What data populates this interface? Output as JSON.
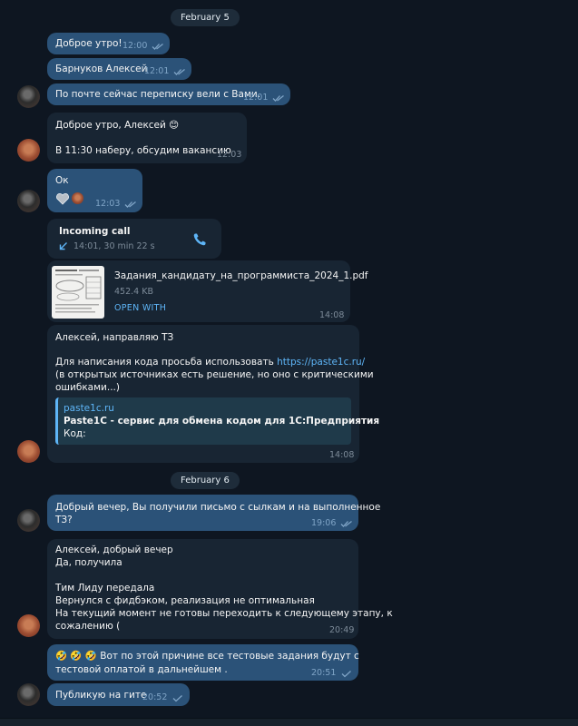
{
  "dates": {
    "d1": "February 5",
    "d2": "February 6"
  },
  "m1": {
    "text": "Доброе утро!",
    "time": "12:00"
  },
  "m2": {
    "text": "Барнуков Алексей",
    "time": "12:01"
  },
  "m3": {
    "text": "По почте сейчас переписку вели с Вами.",
    "time": "12:01"
  },
  "m4": {
    "line1": "Доброе утро, Алексей 😊",
    "line2": "В 11:30 наберу, обсудим вакансию",
    "time": "12:03"
  },
  "m5": {
    "text": "Ок",
    "time": "12:03"
  },
  "call": {
    "title": "Incoming call",
    "details": "14:01, 30 min 22 s"
  },
  "file": {
    "name": "Задания_кандидату_на_программиста_2024_1.pdf",
    "size": "452.4 KB",
    "action": "OPEN WITH",
    "time": "14:08"
  },
  "m7": {
    "line1": "Алексей, направляю ТЗ",
    "line2a": "Для написания кода просьба использовать ",
    "link": "https://paste1c.ru/",
    "line3": "(в открытых источниках есть решение, но оно с критическими",
    "line4": "ошибками...)",
    "preview_site": "paste1c.ru",
    "preview_title": "Paste1C - сервис для обмена кодом для 1С:Предприятия",
    "preview_desc": "Код:",
    "time": "14:08"
  },
  "m8": {
    "line1": "Добрый вечер, Вы получили письмо с сылкам и на выполненное",
    "line2": "ТЗ?",
    "time": "19:06"
  },
  "m9": {
    "line1": "Алексей, добрый вечер",
    "line2": "Да, получила",
    "line3": "Тим Лиду передала",
    "line4": "Вернулся с фидбэком, реализация не оптимальная",
    "line5": "На текущий момент не готовы переходить к следующему этапу, к",
    "line6": "сожалению (",
    "time": "20:49"
  },
  "m10": {
    "line1": "🤣 🤣 🤣 Вот по этой причине все тестовые задания будут с",
    "line2": "тестовой оплатой в дальнейшем .",
    "time": "20:51"
  },
  "m11": {
    "text": "Публикую на гите",
    "time": "20:52"
  },
  "colors": {
    "outgoing": "#2b5278",
    "incoming": "#182533",
    "background": "#0e1621",
    "accent": "#5eb5f7"
  },
  "icons": [
    "double-check-icon",
    "single-check-icon",
    "phone-icon",
    "incoming-arrow-icon",
    "heart-sticker-icon",
    "pdf-thumbnail-icon",
    "avatar-icon"
  ]
}
